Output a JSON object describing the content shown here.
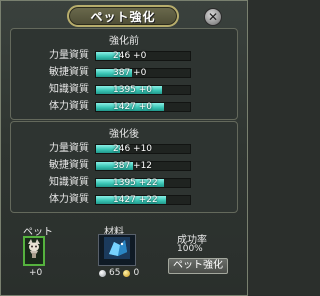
{
  "window": {
    "title": "ペット強化",
    "close_glyph": "✕"
  },
  "before": {
    "header": "強化前",
    "stats": [
      {
        "label": "力量資質",
        "value": "246 +0",
        "fill": 0.25
      },
      {
        "label": "敏捷資質",
        "value": "387 +0",
        "fill": 0.38
      },
      {
        "label": "知識資質",
        "value": "1395 +0",
        "fill": 0.7
      },
      {
        "label": "体力資質",
        "value": "1427 +0",
        "fill": 0.72
      }
    ]
  },
  "after": {
    "header": "強化後",
    "stats": [
      {
        "label": "力量資質",
        "value": "246 +10",
        "fill": 0.26
      },
      {
        "label": "敏捷資質",
        "value": "387 +12",
        "fill": 0.39
      },
      {
        "label": "知識資質",
        "value": "1395 +22",
        "fill": 0.72
      },
      {
        "label": "体力資質",
        "value": "1427 +22",
        "fill": 0.74
      }
    ]
  },
  "pet": {
    "label": "ペット",
    "level": "+0",
    "icon": "pet-portrait-icon"
  },
  "material": {
    "label": "材料",
    "icon": "material-crystal-icon",
    "silver_count": "65",
    "gold_count": "0"
  },
  "success": {
    "label": "成功率",
    "rate": "100%"
  },
  "enhance_button": {
    "label": "ペット強化"
  },
  "colors": {
    "bar_fill": "#3bc7b6",
    "pet_slot_border": "#55b23e",
    "title_border": "#b7ad6c"
  }
}
